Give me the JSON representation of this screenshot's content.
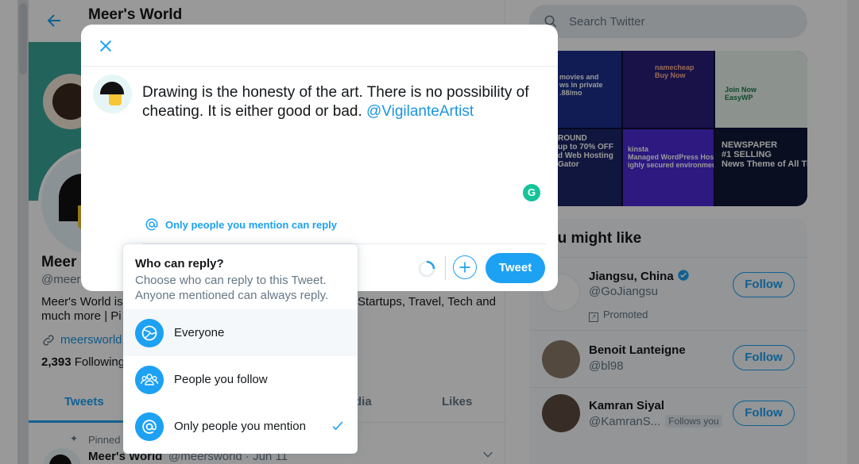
{
  "background": {
    "header_title": "Meer's World",
    "profile": {
      "name": "Meer",
      "handle": "@meers",
      "bio_line1": "Meer's World is",
      "bio_line2": "much more | Pi",
      "bio_right": "Startups, Travel, Tech and",
      "link": "meersworld.",
      "following_count": "2,393",
      "following_label": "Following"
    },
    "tabs": [
      "Tweets",
      "dia",
      "Likes"
    ],
    "pinned_label": "Pinned",
    "tweet": {
      "name": "Meer's World",
      "handle": "@meersworld · Jun 11"
    }
  },
  "sidebar": {
    "search_placeholder": "Search Twitter",
    "ads": [
      {
        "text": "movies and\nws in private\n.88/mo"
      },
      {
        "text": "namecheap\nBuy Now"
      },
      {
        "text": "Join Now\nEasyWP"
      },
      {
        "text": "ROUND\nup to 70% OFF\nd Web Hosting\nGator"
      },
      {
        "text": "kinsta\nManaged WordPress Hosting\nighly secured environment"
      },
      {
        "text": "NEWSPAPER\n#1 SELLING\nNews Theme of All Time"
      }
    ],
    "who_to_follow": {
      "title": "ou might like",
      "accounts": [
        {
          "name": "Jiangsu, China",
          "handle": "@GoJiangsu",
          "promoted": "Promoted",
          "button": "Follow"
        },
        {
          "name": "Benoit Lanteigne",
          "handle": "@bl98",
          "button": "Follow"
        },
        {
          "name": "Kamran Siyal",
          "handle": "@KamranS...",
          "badge": "Follows you",
          "button": "Follow"
        }
      ]
    }
  },
  "composer": {
    "text": "Drawing is the honesty of the art. There is no possibility of cheating. It is either good or bad.",
    "mention": "@VigilanteArtist",
    "grammarly_label": "G",
    "reply_setting": "Only people you mention can reply",
    "tweet_button": "Tweet"
  },
  "dropdown": {
    "title": "Who can reply?",
    "description": "Choose who can reply to this Tweet. Anyone mentioned can always reply.",
    "options": [
      {
        "label": "Everyone",
        "icon": "globe-icon"
      },
      {
        "label": "People you follow",
        "icon": "people-icon"
      },
      {
        "label": "Only people you mention",
        "icon": "at-icon"
      }
    ],
    "highlighted_option": "Everyone",
    "checked_option": "Only people you mention"
  },
  "colors": {
    "accent": "#1da1f2",
    "text": "#14171a",
    "secondary_text": "#657786"
  }
}
